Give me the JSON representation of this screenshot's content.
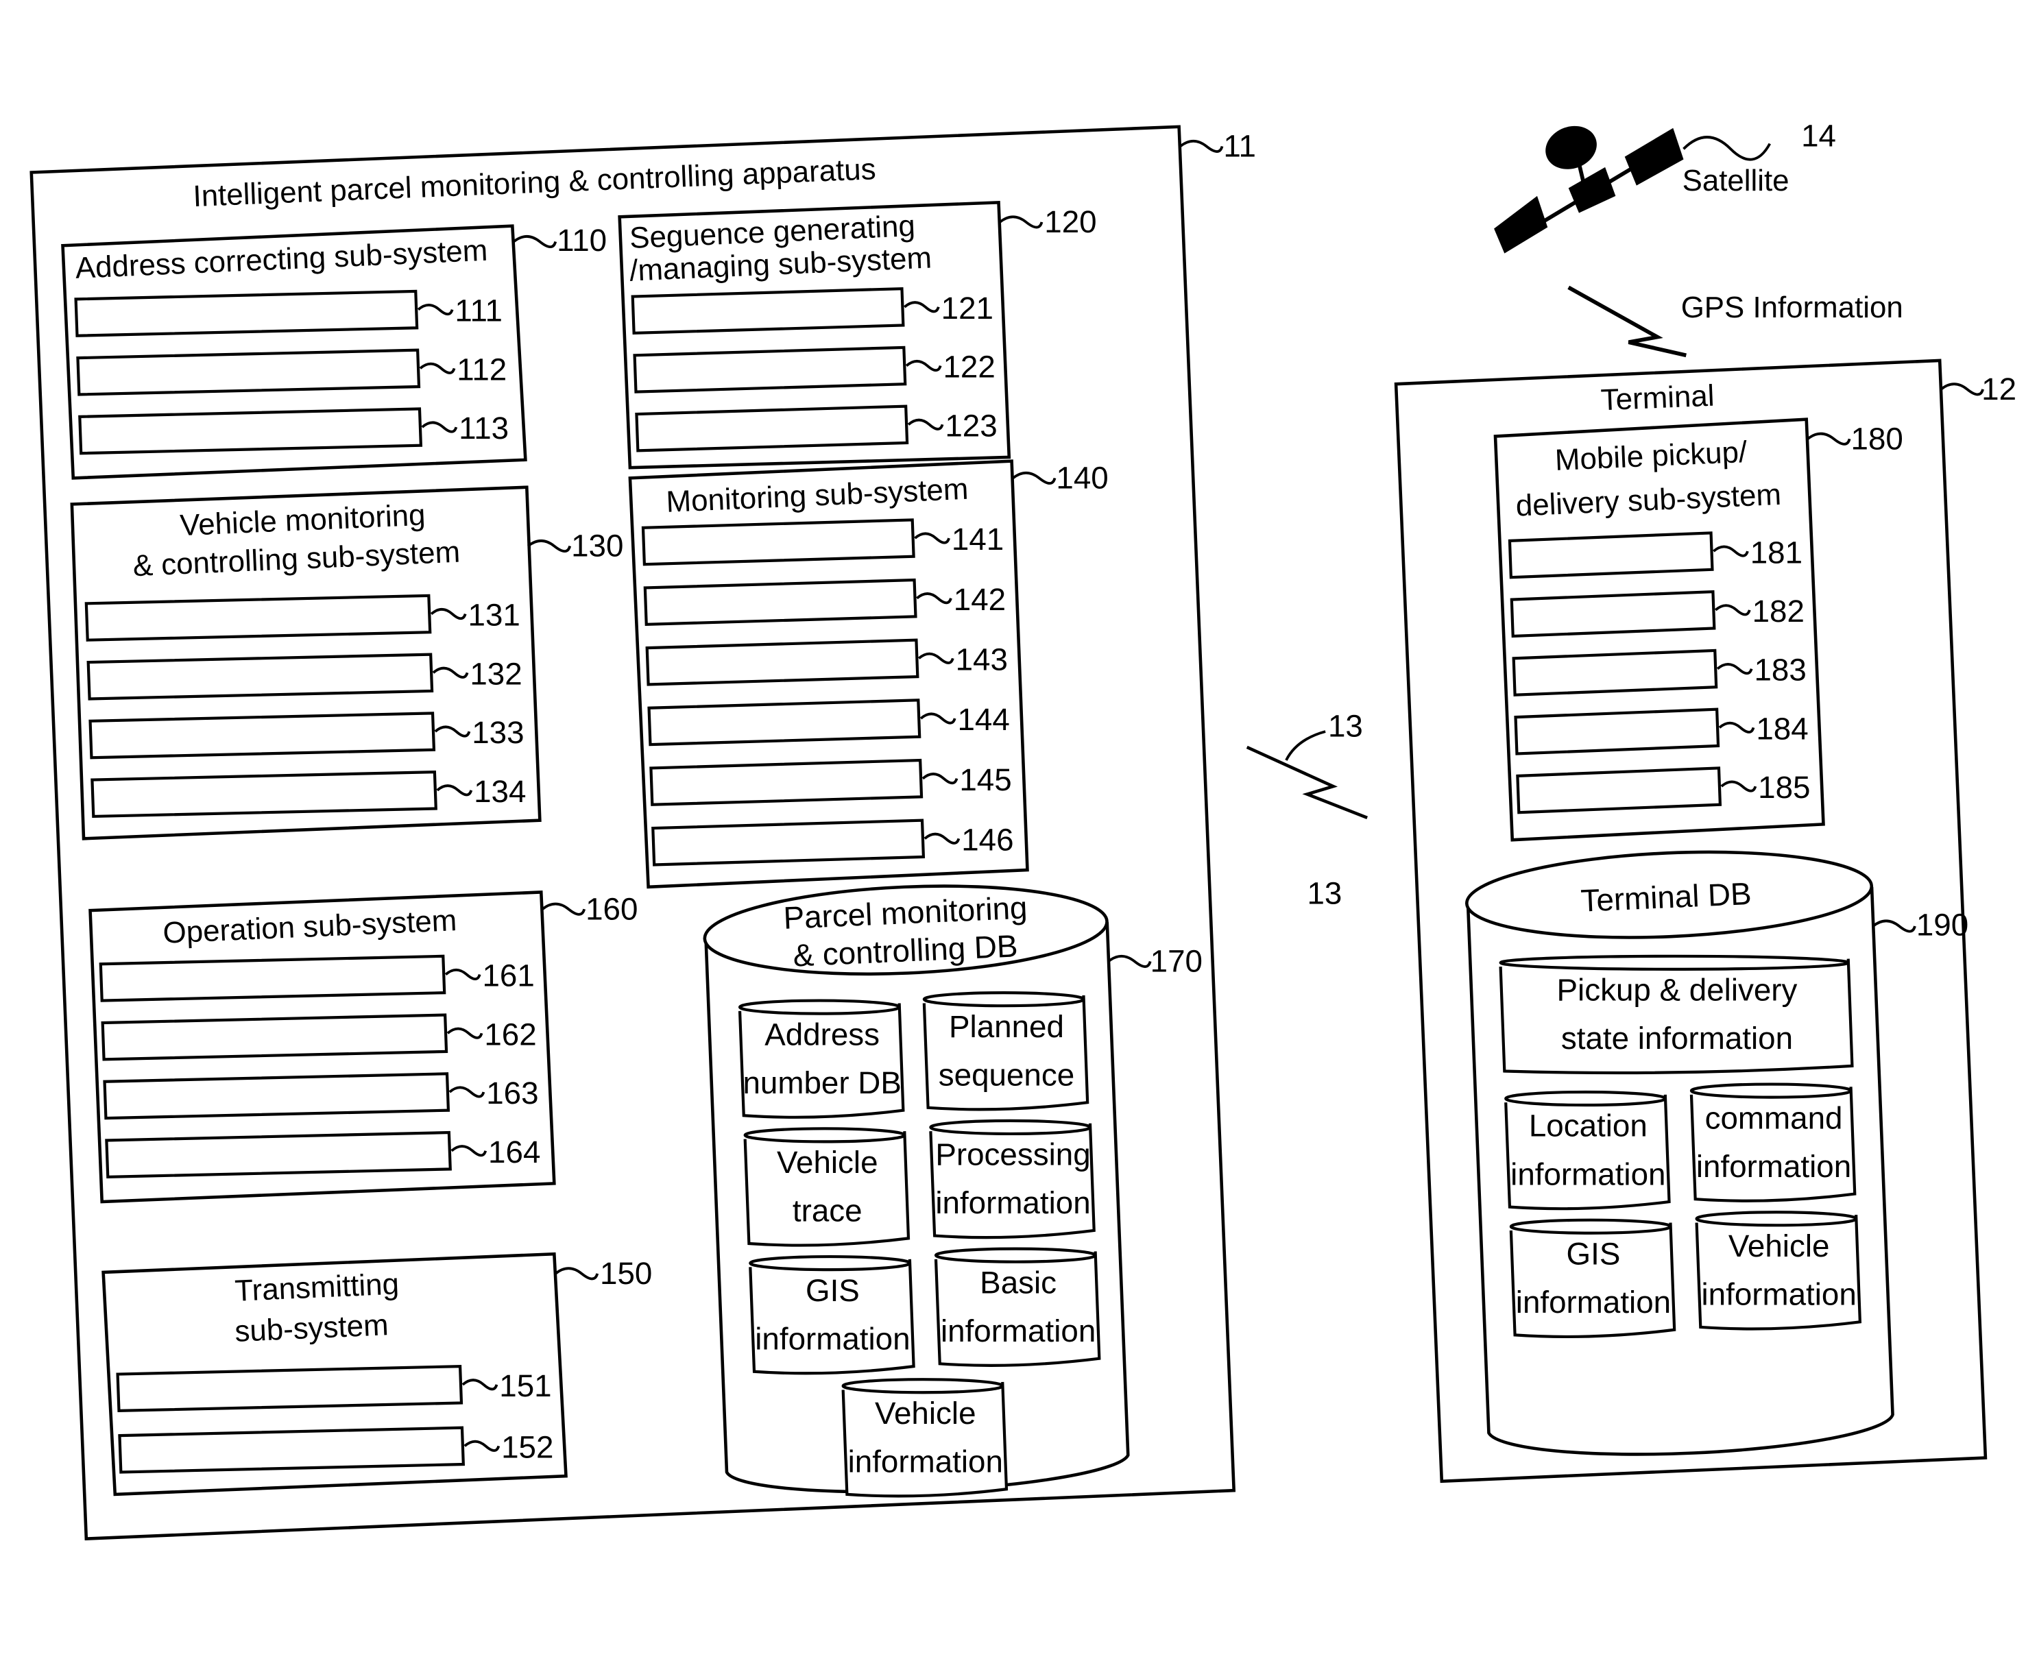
{
  "apparatus": {
    "title": "Intelligent parcel monitoring & controlling apparatus",
    "ref": "11",
    "subsystems": {
      "address": {
        "title": "Address correcting sub-system",
        "ref": "110",
        "items": [
          "111",
          "112",
          "113"
        ]
      },
      "sequence": {
        "title_line1": "Seguence generating",
        "title_line2": "/managing sub-system",
        "ref": "120",
        "items": [
          "121",
          "122",
          "123"
        ]
      },
      "vehicle": {
        "title_line1": "Vehicle monitoring",
        "title_line2": "& controlling sub-system",
        "ref": "130",
        "items": [
          "131",
          "132",
          "133",
          "134"
        ]
      },
      "monitoring": {
        "title": "Monitoring sub-system",
        "ref": "140",
        "items": [
          "141",
          "142",
          "143",
          "144",
          "145",
          "146"
        ]
      },
      "operation": {
        "title": "Operation sub-system",
        "ref": "160",
        "items": [
          "161",
          "162",
          "163",
          "164"
        ]
      },
      "transmitting": {
        "title_line1": "Transmitting",
        "title_line2": "sub-system",
        "ref": "150",
        "items": [
          "151",
          "152"
        ]
      }
    },
    "db": {
      "title_line1": "Parcel monitoring",
      "title_line2": "& controlling DB",
      "ref": "170",
      "stores": [
        [
          "Address",
          "number DB"
        ],
        [
          "Planned",
          "sequence"
        ],
        [
          "Vehicle",
          "trace"
        ],
        [
          "Processing",
          "information"
        ],
        [
          "GIS",
          "information"
        ],
        [
          "Basic",
          "information"
        ],
        [
          "Vehicle",
          "information"
        ]
      ]
    }
  },
  "link": {
    "ref_top": "13",
    "ref_bottom": "13"
  },
  "satellite": {
    "label": "Satellite",
    "ref": "14",
    "signal_label": "GPS Information"
  },
  "terminal": {
    "title": "Terminal",
    "ref": "12",
    "subsystem": {
      "title_line1": "Mobile pickup/",
      "title_line2": "delivery sub-system",
      "ref": "180",
      "items": [
        "181",
        "182",
        "183",
        "184",
        "185"
      ]
    },
    "db": {
      "title": "Terminal DB",
      "ref": "190",
      "stores": [
        [
          "Pickup & delivery",
          "state information"
        ],
        [
          "Location",
          "information"
        ],
        [
          "command",
          "information"
        ],
        [
          "GIS",
          "information"
        ],
        [
          "Vehicle",
          "information"
        ]
      ]
    }
  }
}
